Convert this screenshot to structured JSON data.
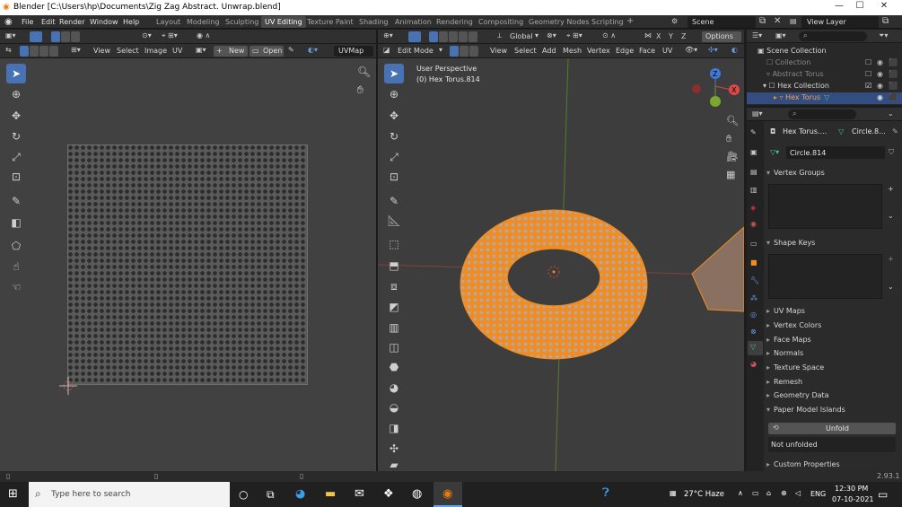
{
  "window": {
    "title": "Blender [C:\\Users\\hp\\Documents\\Zig Zag Abstract. Unwrap.blend]",
    "minimize": "—",
    "maximize": "☐",
    "close": "✕"
  },
  "menu": {
    "items": [
      "File",
      "Edit",
      "Render",
      "Window",
      "Help"
    ]
  },
  "workspaces": [
    "Layout",
    "Modeling",
    "Sculpting",
    "UV Editing",
    "Texture Paint",
    "Shading",
    "Animation",
    "Rendering",
    "Compositing",
    "Geometry Nodes",
    "Scripting"
  ],
  "scene": {
    "scene_name": "Scene",
    "view_layer": "View Layer"
  },
  "uv_editor": {
    "menus": [
      "View",
      "Select",
      "Image",
      "UV"
    ],
    "new_label": "New",
    "open_label": "Open",
    "uvmap": "UVMap"
  },
  "viewport": {
    "mode": "Edit Mode",
    "menus": [
      "View",
      "Select",
      "Add",
      "Mesh",
      "Vertex",
      "Edge",
      "Face",
      "UV"
    ],
    "orientation": "Global",
    "options": "Options",
    "xyz": [
      "X",
      "Y",
      "Z"
    ],
    "info_line1": "User Perspective",
    "info_line2": "(0) Hex Torus.814"
  },
  "outliner": {
    "items": [
      {
        "label": "Scene Collection"
      },
      {
        "label": "Collection"
      },
      {
        "label": "Abstract Torus"
      },
      {
        "label": "Hex Collection"
      },
      {
        "label": "Hex Torus"
      }
    ]
  },
  "properties": {
    "object_name": "Hex Torus....",
    "mesh_name": "Circle.8...",
    "mesh_field": "Circle.814",
    "panels": {
      "vertex_groups": "Vertex Groups",
      "shape_keys": "Shape Keys",
      "uv_maps": "UV Maps",
      "vertex_colors": "Vertex Colors",
      "face_maps": "Face Maps",
      "normals": "Normals",
      "texture_space": "Texture Space",
      "remesh": "Remesh",
      "geometry_data": "Geometry Data",
      "paper_model": "Paper Model Islands",
      "custom_props": "Custom Properties"
    },
    "unfold_label": "Unfold",
    "not_unfolded": "Not unfolded"
  },
  "status": {
    "version": "2.93.1"
  },
  "taskbar": {
    "search_placeholder": "Type here to search",
    "weather": "27°C Haze",
    "lang": "ENG",
    "time": "12:30 PM",
    "date": "07-10-2021"
  },
  "colors": {
    "accent": "#4772b3",
    "selection": "#f08c20"
  }
}
